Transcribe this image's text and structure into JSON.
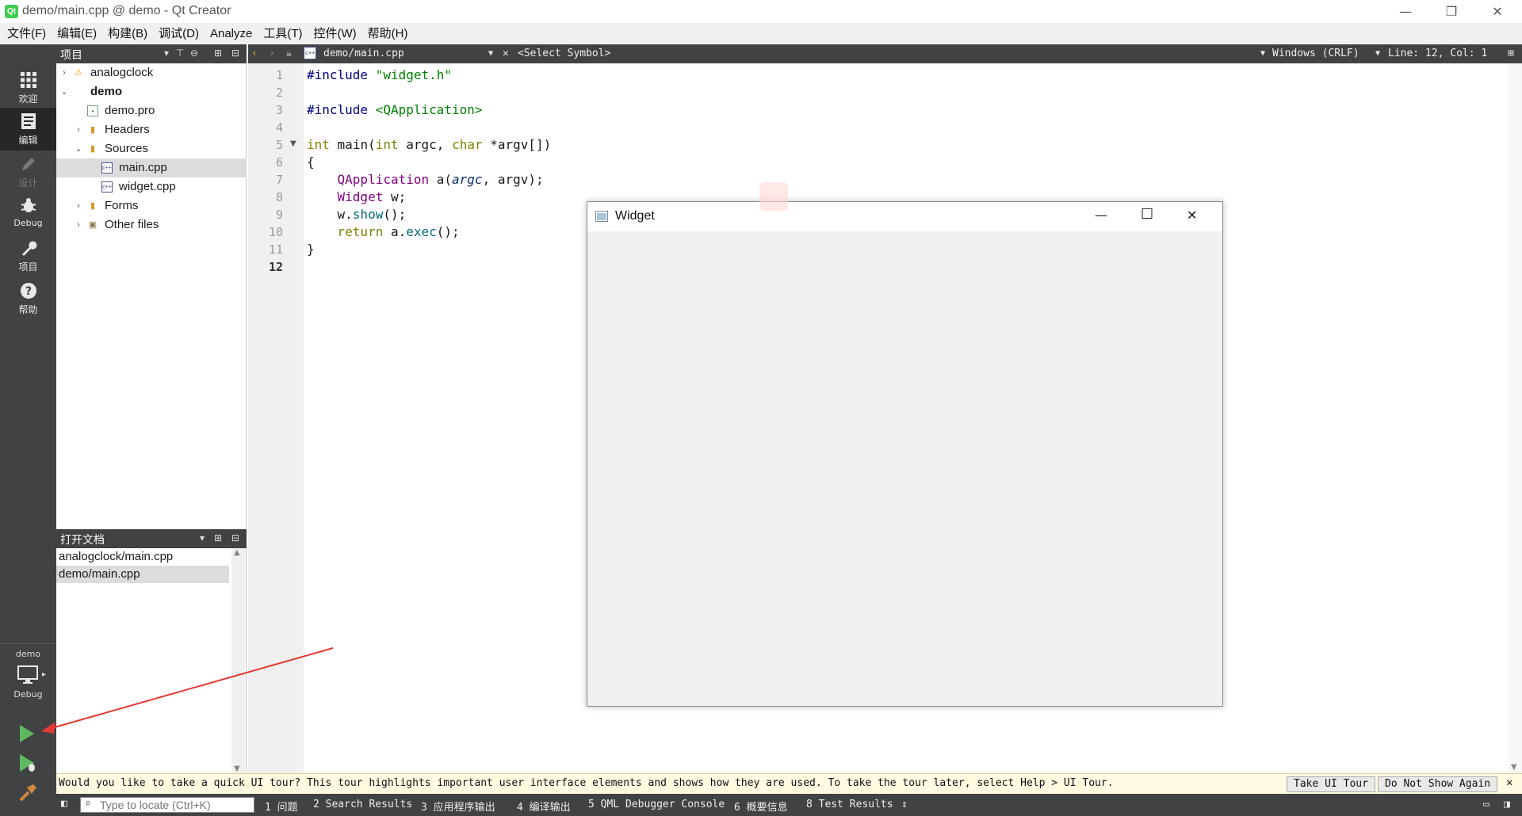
{
  "window": {
    "title": "demo/main.cpp @ demo - Qt Creator",
    "logo_text": "Qt",
    "controls": {
      "minimize": "—",
      "maximize": "❐",
      "close": "✕"
    }
  },
  "menu": [
    "文件(F)",
    "编辑(E)",
    "构建(B)",
    "调试(D)",
    "Analyze",
    "工具(T)",
    "控件(W)",
    "帮助(H)"
  ],
  "modes": [
    {
      "label": "欢迎",
      "icon": "grid-icon"
    },
    {
      "label": "编辑",
      "icon": "edit-document-icon"
    },
    {
      "label": "设计",
      "icon": "pencil-icon"
    },
    {
      "label": "Debug",
      "icon": "bug-icon"
    },
    {
      "label": "项目",
      "icon": "wrench-icon"
    },
    {
      "label": "帮助",
      "icon": "help-icon"
    }
  ],
  "kit": {
    "project": "demo",
    "config": "Debug"
  },
  "projects_panel": {
    "title": "项目",
    "tree": [
      {
        "label": "analogclock",
        "icon": "warning-icon",
        "expanded": false
      },
      {
        "label": "demo",
        "bold": true,
        "expanded": true
      },
      {
        "label": "demo.pro"
      },
      {
        "label": "Headers",
        "expanded": false
      },
      {
        "label": "Sources",
        "expanded": true
      },
      {
        "label": "main.cpp",
        "selected": true
      },
      {
        "label": "widget.cpp"
      },
      {
        "label": "Forms",
        "expanded": false
      },
      {
        "label": "Other files",
        "expanded": false
      }
    ]
  },
  "open_documents": {
    "title": "打开文档",
    "items": [
      "analogclock/main.cpp",
      "demo/main.cpp"
    ],
    "selected": "demo/main.cpp"
  },
  "editor_toolbar": {
    "file": "demo/main.cpp",
    "symbol": "<Select Symbol>",
    "line_endings": "Windows (CRLF)",
    "position": "Line: 12, Col: 1"
  },
  "editor": {
    "line_numbers": [
      "1",
      "2",
      "3",
      "4",
      "5",
      "6",
      "7",
      "8",
      "9",
      "10",
      "11",
      "12"
    ],
    "current_line": "12",
    "code": {
      "l1_directive": "#include",
      "l1_file": "\"widget.h\"",
      "l3_directive": "#include",
      "l3_file": "<QApplication>",
      "l5_ret": "int",
      "l5_name": "main(",
      "l5_type1": "int",
      "l5_param1": "argc,",
      "l5_type2": "char",
      "l5_param2": "*argv[])",
      "l6": "{",
      "l7_type": "QApplication",
      "l7_rest": "a(",
      "l7_arg1": "argc",
      "l7_rest2": ", argv);",
      "l8_type": "Widget",
      "l8_rest": "w;",
      "l9_obj": "w.",
      "l9_fn": "show",
      "l9_rest": "();",
      "l10_kw": "return",
      "l10_rest": "a.",
      "l10_fn": "exec",
      "l10_end": "();",
      "l11": "}"
    }
  },
  "info_bar": {
    "message": "Would you like to take a quick UI tour? This tour highlights important user interface elements and shows how they are used. To take the tour later, select Help > UI Tour.",
    "take_tour": "Take UI Tour",
    "dont_show": "Do Not Show Again",
    "close": "✕"
  },
  "status_bar": {
    "locator_placeholder": "Type to locate (Ctrl+K)",
    "panes": [
      "1 问题",
      "2 Search Results",
      "3 应用程序输出",
      "4 编译输出",
      "5 QML Debugger Console",
      "6 概要信息",
      "8 Test Results"
    ]
  },
  "widget_window": {
    "title": "Widget",
    "minimize": "—",
    "maximize": "☐",
    "close": "✕"
  },
  "colors": {
    "sidebar": "#404244",
    "sidebar_active": "#262728",
    "run_green": "#5fb85f",
    "arrow_red": "#e53935"
  }
}
